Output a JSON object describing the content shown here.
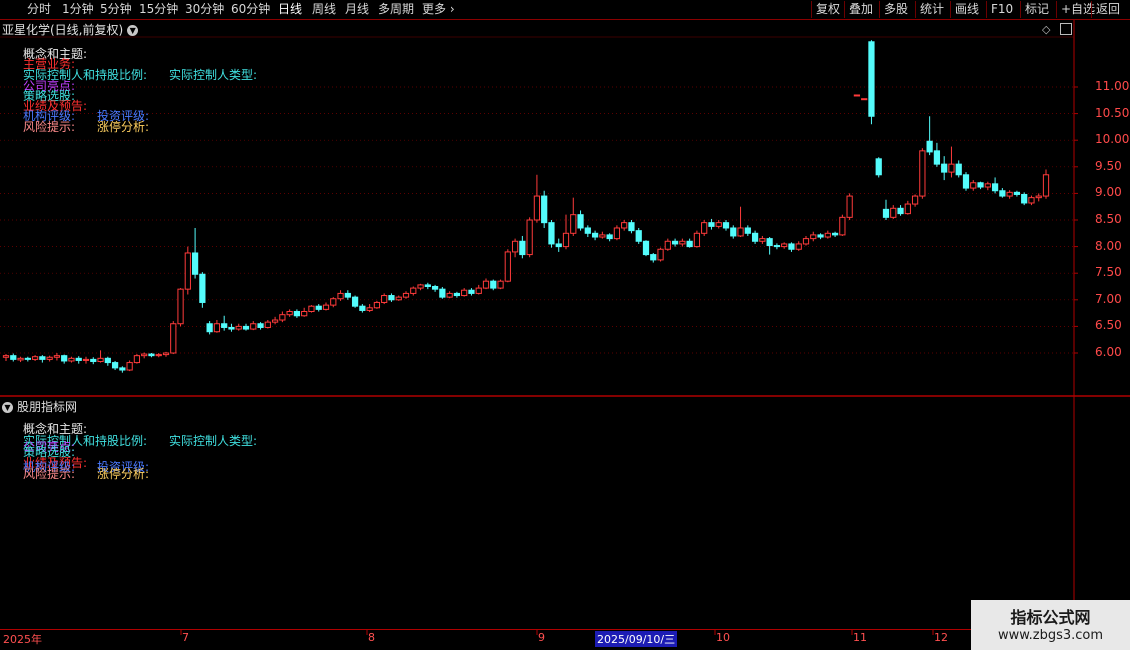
{
  "toolbar": {
    "periods": [
      "分时",
      "1分钟",
      "5分钟",
      "15分钟",
      "30分钟",
      "60分钟",
      "日线",
      "周线",
      "月线",
      "多周期",
      "更多"
    ],
    "active_period": "日线",
    "actions": [
      "复权",
      "叠加",
      "多股",
      "统计",
      "画线",
      "F10",
      "标记",
      "+自选",
      "返回"
    ]
  },
  "main_panel": {
    "title": "亚星化学(日线,前复权)",
    "info": {
      "concept": "概念和主题:",
      "main_business": "主营业务:",
      "controller": "实际控制人和持股比例:",
      "controller_type": "实际控制人类型:",
      "company_highlight": "公司亮点:",
      "strategy": "策略选股:",
      "forecast": "业绩及预告:",
      "rating": "机构评级:",
      "invest_rating": "投资评级:",
      "risk": "风险提示:",
      "limit_up": "涨停分析:"
    }
  },
  "sub_panel": {
    "title": "股朋指标网",
    "info": {
      "concept": "概念和主题:",
      "controller": "实际控制人和持股比例:",
      "controller_type": "实际控制人类型:",
      "company_highlight": "公司亮点:",
      "strategy": "策略选股:",
      "forecast": "业绩及预告:",
      "rating": "机构评级:",
      "invest_rating": "投资评级:",
      "risk": "风险提示:",
      "limit_up": "涨停分析:"
    }
  },
  "watermark": {
    "line1": "指标公式网",
    "line2": "www.zbgs3.com"
  },
  "colors": {
    "up": "#ff3b3b",
    "down": "#54fcfc",
    "axis": "#b00000",
    "grid": "#7a0000"
  },
  "chart_data": {
    "type": "candlestick",
    "y_ticks": [
      "11.00",
      "10.50",
      "10.00",
      "9.50",
      "9.00",
      "8.50",
      "8.00",
      "7.50",
      "7.00",
      "6.50",
      "6.00"
    ],
    "ylim": [
      5.5,
      11.9
    ],
    "x_labels": [
      "2025年",
      "7",
      "8",
      "9",
      "2025/09/10/三",
      "10",
      "11",
      "12"
    ],
    "candles": [
      [
        5.92,
        5.95,
        5.85,
        5.98
      ],
      [
        5.95,
        5.88,
        5.84,
        5.99
      ],
      [
        5.87,
        5.9,
        5.83,
        5.93
      ],
      [
        5.9,
        5.88,
        5.84,
        5.93
      ],
      [
        5.88,
        5.93,
        5.85,
        5.96
      ],
      [
        5.93,
        5.88,
        5.82,
        5.96
      ],
      [
        5.88,
        5.92,
        5.84,
        5.95
      ],
      [
        5.92,
        5.95,
        5.86,
        6.0
      ],
      [
        5.95,
        5.85,
        5.8,
        5.97
      ],
      [
        5.85,
        5.9,
        5.82,
        5.93
      ],
      [
        5.9,
        5.86,
        5.8,
        5.94
      ],
      [
        5.86,
        5.88,
        5.8,
        5.93
      ],
      [
        5.88,
        5.84,
        5.79,
        5.92
      ],
      [
        5.84,
        5.9,
        5.82,
        6.05
      ],
      [
        5.9,
        5.82,
        5.76,
        5.93
      ],
      [
        5.82,
        5.72,
        5.68,
        5.85
      ],
      [
        5.72,
        5.68,
        5.63,
        5.75
      ],
      [
        5.68,
        5.82,
        5.66,
        5.86
      ],
      [
        5.82,
        5.95,
        5.8,
        5.98
      ],
      [
        5.95,
        5.98,
        5.9,
        6.01
      ],
      [
        5.98,
        5.95,
        5.92,
        6.0
      ],
      [
        5.95,
        5.97,
        5.92,
        6.0
      ],
      [
        5.97,
        6.0,
        5.93,
        6.02
      ],
      [
        6.0,
        6.55,
        5.98,
        6.6
      ],
      [
        6.55,
        7.2,
        6.5,
        7.22
      ],
      [
        7.2,
        7.88,
        7.1,
        8.0
      ],
      [
        7.88,
        7.48,
        7.4,
        8.35
      ],
      [
        7.48,
        6.95,
        6.85,
        7.52
      ],
      [
        6.55,
        6.4,
        6.35,
        6.6
      ],
      [
        6.4,
        6.55,
        6.38,
        6.62
      ],
      [
        6.55,
        6.48,
        6.42,
        6.7
      ],
      [
        6.48,
        6.45,
        6.4,
        6.55
      ],
      [
        6.45,
        6.5,
        6.42,
        6.55
      ],
      [
        6.5,
        6.45,
        6.42,
        6.55
      ],
      [
        6.45,
        6.55,
        6.43,
        6.6
      ],
      [
        6.55,
        6.48,
        6.44,
        6.58
      ],
      [
        6.48,
        6.58,
        6.46,
        6.62
      ],
      [
        6.58,
        6.62,
        6.54,
        6.68
      ],
      [
        6.62,
        6.72,
        6.58,
        6.78
      ],
      [
        6.72,
        6.78,
        6.68,
        6.82
      ],
      [
        6.78,
        6.7,
        6.66,
        6.82
      ],
      [
        6.7,
        6.78,
        6.68,
        6.85
      ],
      [
        6.78,
        6.88,
        6.76,
        6.9
      ],
      [
        6.88,
        6.82,
        6.78,
        6.92
      ],
      [
        6.82,
        6.9,
        6.8,
        6.95
      ],
      [
        6.9,
        7.02,
        6.86,
        7.05
      ],
      [
        7.02,
        7.12,
        6.98,
        7.18
      ],
      [
        7.12,
        7.05,
        7.0,
        7.18
      ],
      [
        7.05,
        6.88,
        6.85,
        7.08
      ],
      [
        6.88,
        6.8,
        6.76,
        6.92
      ],
      [
        6.8,
        6.85,
        6.77,
        6.92
      ],
      [
        6.85,
        6.95,
        6.83,
        6.98
      ],
      [
        6.95,
        7.08,
        6.92,
        7.12
      ],
      [
        7.08,
        7.0,
        6.96,
        7.12
      ],
      [
        7.0,
        7.05,
        6.98,
        7.08
      ],
      [
        7.05,
        7.12,
        7.02,
        7.16
      ],
      [
        7.12,
        7.22,
        7.08,
        7.25
      ],
      [
        7.22,
        7.28,
        7.18,
        7.3
      ],
      [
        7.28,
        7.25,
        7.2,
        7.32
      ],
      [
        7.25,
        7.2,
        7.15,
        7.28
      ],
      [
        7.2,
        7.05,
        7.02,
        7.24
      ],
      [
        7.05,
        7.12,
        7.03,
        7.16
      ],
      [
        7.12,
        7.08,
        7.04,
        7.15
      ],
      [
        7.08,
        7.18,
        7.06,
        7.22
      ],
      [
        7.18,
        7.12,
        7.08,
        7.22
      ],
      [
        7.12,
        7.22,
        7.1,
        7.28
      ],
      [
        7.22,
        7.35,
        7.2,
        7.4
      ],
      [
        7.35,
        7.22,
        7.18,
        7.38
      ],
      [
        7.22,
        7.35,
        7.2,
        7.38
      ],
      [
        7.35,
        7.9,
        7.33,
        7.95
      ],
      [
        7.9,
        8.1,
        7.8,
        8.15
      ],
      [
        8.1,
        7.85,
        7.78,
        8.2
      ],
      [
        7.85,
        8.5,
        7.8,
        8.55
      ],
      [
        8.5,
        8.95,
        8.45,
        9.35
      ],
      [
        8.95,
        8.45,
        8.35,
        9.05
      ],
      [
        8.45,
        8.05,
        7.98,
        8.5
      ],
      [
        8.05,
        8.0,
        7.9,
        8.15
      ],
      [
        8.0,
        8.25,
        7.95,
        8.6
      ],
      [
        8.25,
        8.6,
        8.2,
        8.92
      ],
      [
        8.6,
        8.35,
        8.3,
        8.68
      ],
      [
        8.35,
        8.25,
        8.18,
        8.4
      ],
      [
        8.25,
        8.18,
        8.12,
        8.3
      ],
      [
        8.18,
        8.22,
        8.15,
        8.28
      ],
      [
        8.22,
        8.15,
        8.1,
        8.25
      ],
      [
        8.15,
        8.35,
        8.12,
        8.4
      ],
      [
        8.35,
        8.45,
        8.3,
        8.5
      ],
      [
        8.45,
        8.3,
        8.25,
        8.5
      ],
      [
        8.3,
        8.1,
        8.05,
        8.35
      ],
      [
        8.1,
        7.85,
        7.82,
        8.12
      ],
      [
        7.85,
        7.75,
        7.7,
        7.88
      ],
      [
        7.75,
        7.95,
        7.72,
        7.98
      ],
      [
        7.95,
        8.1,
        7.92,
        8.15
      ],
      [
        8.1,
        8.05,
        8.0,
        8.15
      ],
      [
        8.05,
        8.1,
        8.0,
        8.15
      ],
      [
        8.1,
        8.0,
        7.98,
        8.15
      ],
      [
        8.0,
        8.25,
        7.98,
        8.3
      ],
      [
        8.25,
        8.45,
        8.2,
        8.5
      ],
      [
        8.45,
        8.38,
        8.32,
        8.52
      ],
      [
        8.38,
        8.45,
        8.34,
        8.5
      ],
      [
        8.45,
        8.35,
        8.3,
        8.5
      ],
      [
        8.35,
        8.2,
        8.15,
        8.4
      ],
      [
        8.2,
        8.35,
        8.18,
        8.75
      ],
      [
        8.35,
        8.25,
        8.2,
        8.4
      ],
      [
        8.25,
        8.1,
        8.05,
        8.3
      ],
      [
        8.1,
        8.15,
        8.05,
        8.2
      ],
      [
        8.15,
        8.02,
        7.85,
        8.18
      ],
      [
        8.02,
        8.0,
        7.95,
        8.06
      ],
      [
        8.0,
        8.05,
        7.96,
        8.08
      ],
      [
        8.05,
        7.95,
        7.9,
        8.08
      ],
      [
        7.95,
        8.05,
        7.92,
        8.1
      ],
      [
        8.05,
        8.15,
        8.02,
        8.2
      ],
      [
        8.15,
        8.22,
        8.1,
        8.28
      ],
      [
        8.22,
        8.18,
        8.14,
        8.25
      ],
      [
        8.18,
        8.25,
        8.15,
        8.3
      ],
      [
        8.25,
        8.22,
        8.18,
        8.28
      ],
      [
        8.22,
        8.55,
        8.2,
        8.6
      ],
      [
        8.55,
        8.95,
        8.5,
        9.0
      ],
      [
        10.85,
        10.85,
        10.85,
        10.85
      ],
      [
        10.78,
        10.78,
        10.78,
        10.78
      ],
      [
        11.85,
        10.45,
        10.3,
        11.88
      ],
      [
        9.65,
        9.35,
        9.3,
        9.68
      ],
      [
        8.7,
        8.55,
        8.5,
        8.88
      ],
      [
        8.55,
        8.72,
        8.52,
        8.78
      ],
      [
        8.72,
        8.62,
        8.58,
        8.78
      ],
      [
        8.62,
        8.8,
        8.6,
        8.86
      ],
      [
        8.8,
        8.95,
        8.75,
        8.98
      ],
      [
        8.95,
        9.8,
        8.9,
        9.85
      ],
      [
        9.98,
        9.78,
        9.72,
        10.45
      ],
      [
        9.8,
        9.55,
        9.5,
        9.95
      ],
      [
        9.55,
        9.4,
        9.25,
        9.7
      ],
      [
        9.4,
        9.55,
        9.3,
        9.88
      ],
      [
        9.55,
        9.35,
        9.3,
        9.62
      ],
      [
        9.35,
        9.1,
        9.05,
        9.4
      ],
      [
        9.1,
        9.2,
        9.05,
        9.25
      ],
      [
        9.2,
        9.12,
        9.08,
        9.22
      ],
      [
        9.12,
        9.18,
        9.06,
        9.22
      ],
      [
        9.18,
        9.05,
        9.0,
        9.3
      ],
      [
        9.05,
        8.95,
        8.92,
        9.1
      ],
      [
        8.95,
        9.02,
        8.9,
        9.06
      ],
      [
        9.02,
        8.98,
        8.94,
        9.05
      ],
      [
        8.98,
        8.82,
        8.78,
        9.02
      ],
      [
        8.82,
        8.92,
        8.78,
        8.96
      ],
      [
        8.92,
        8.95,
        8.85,
        9.0
      ],
      [
        8.95,
        9.35,
        8.9,
        9.45
      ]
    ]
  }
}
